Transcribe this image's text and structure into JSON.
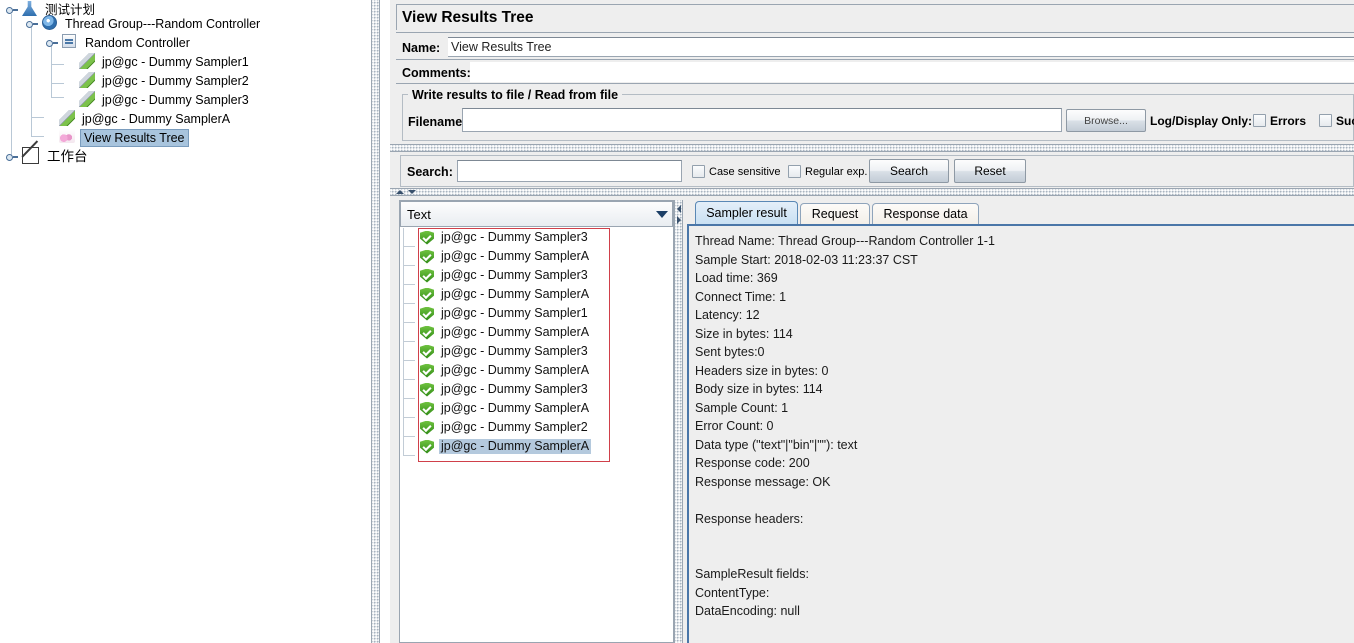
{
  "tree": {
    "nodes": [
      {
        "label": "测试计划",
        "icon": "test-plan-icon",
        "indent": 0,
        "selected": false
      },
      {
        "label": "Thread Group---Random Controller",
        "icon": "thread-group-icon",
        "indent": 1,
        "selected": false
      },
      {
        "label": "Random Controller",
        "icon": "random-controller-icon",
        "indent": 2,
        "selected": false
      },
      {
        "label": "jp@gc - Dummy Sampler1",
        "icon": "dummy-sampler-icon",
        "indent": 3,
        "selected": false
      },
      {
        "label": "jp@gc - Dummy Sampler2",
        "icon": "dummy-sampler-icon",
        "indent": 3,
        "selected": false
      },
      {
        "label": "jp@gc - Dummy Sampler3",
        "icon": "dummy-sampler-icon",
        "indent": 3,
        "selected": false
      },
      {
        "label": "jp@gc - Dummy SamplerA",
        "icon": "dummy-sampler-icon",
        "indent": 2,
        "selected": false
      },
      {
        "label": "View Results Tree",
        "icon": "view-results-tree-icon",
        "indent": 2,
        "selected": true
      },
      {
        "label": "工作台",
        "icon": "workbench-icon",
        "indent": 0,
        "selected": false
      }
    ]
  },
  "panel": {
    "title": "View Results Tree",
    "name_label": "Name:",
    "name_value": "View Results Tree",
    "comments_label": "Comments:",
    "comments_value": "",
    "group_title": "Write results to file / Read from file",
    "filename_label": "Filename",
    "filename_value": "",
    "browse_label": "Browse...",
    "log_display_label": "Log/Display Only:",
    "errors_label": "Errors",
    "successes_label": "Suc"
  },
  "search": {
    "label": "Search:",
    "value": "",
    "case_sensitive_label": "Case sensitive",
    "regular_exp_label": "Regular exp.",
    "search_button": "Search",
    "reset_button": "Reset"
  },
  "results": {
    "renderer_selected": "Text",
    "items": [
      {
        "label": "jp@gc - Dummy Sampler3",
        "status": "success",
        "selected": false
      },
      {
        "label": "jp@gc - Dummy SamplerA",
        "status": "success",
        "selected": false
      },
      {
        "label": "jp@gc - Dummy Sampler3",
        "status": "success",
        "selected": false
      },
      {
        "label": "jp@gc - Dummy SamplerA",
        "status": "success",
        "selected": false
      },
      {
        "label": "jp@gc - Dummy Sampler1",
        "status": "success",
        "selected": false
      },
      {
        "label": "jp@gc - Dummy SamplerA",
        "status": "success",
        "selected": false
      },
      {
        "label": "jp@gc - Dummy Sampler3",
        "status": "success",
        "selected": false
      },
      {
        "label": "jp@gc - Dummy SamplerA",
        "status": "success",
        "selected": false
      },
      {
        "label": "jp@gc - Dummy Sampler3",
        "status": "success",
        "selected": false
      },
      {
        "label": "jp@gc - Dummy SamplerA",
        "status": "success",
        "selected": false
      },
      {
        "label": "jp@gc - Dummy Sampler2",
        "status": "success",
        "selected": false
      },
      {
        "label": "jp@gc - Dummy SamplerA",
        "status": "success",
        "selected": true
      }
    ]
  },
  "detail": {
    "tabs": [
      {
        "label": "Sampler result",
        "active": true
      },
      {
        "label": "Request",
        "active": false
      },
      {
        "label": "Response data",
        "active": false
      }
    ],
    "text": "Thread Name: Thread Group---Random Controller 1-1\nSample Start: 2018-02-03 11:23:37 CST\nLoad time: 369\nConnect Time: 1\nLatency: 12\nSize in bytes: 114\nSent bytes:0\nHeaders size in bytes: 0\nBody size in bytes: 114\nSample Count: 1\nError Count: 0\nData type (\"text\"|\"bin\"|\"\"): text\nResponse code: 200\nResponse message: OK\n\nResponse headers:\n\n\nSampleResult fields:\nContentType:\nDataEncoding: null"
  },
  "colors": {
    "accent": "#4a76a8",
    "success": "#2f8a16",
    "selection": "#b4c9dd",
    "annotation": "#d0404a",
    "panel_bg": "#eeeeee"
  }
}
